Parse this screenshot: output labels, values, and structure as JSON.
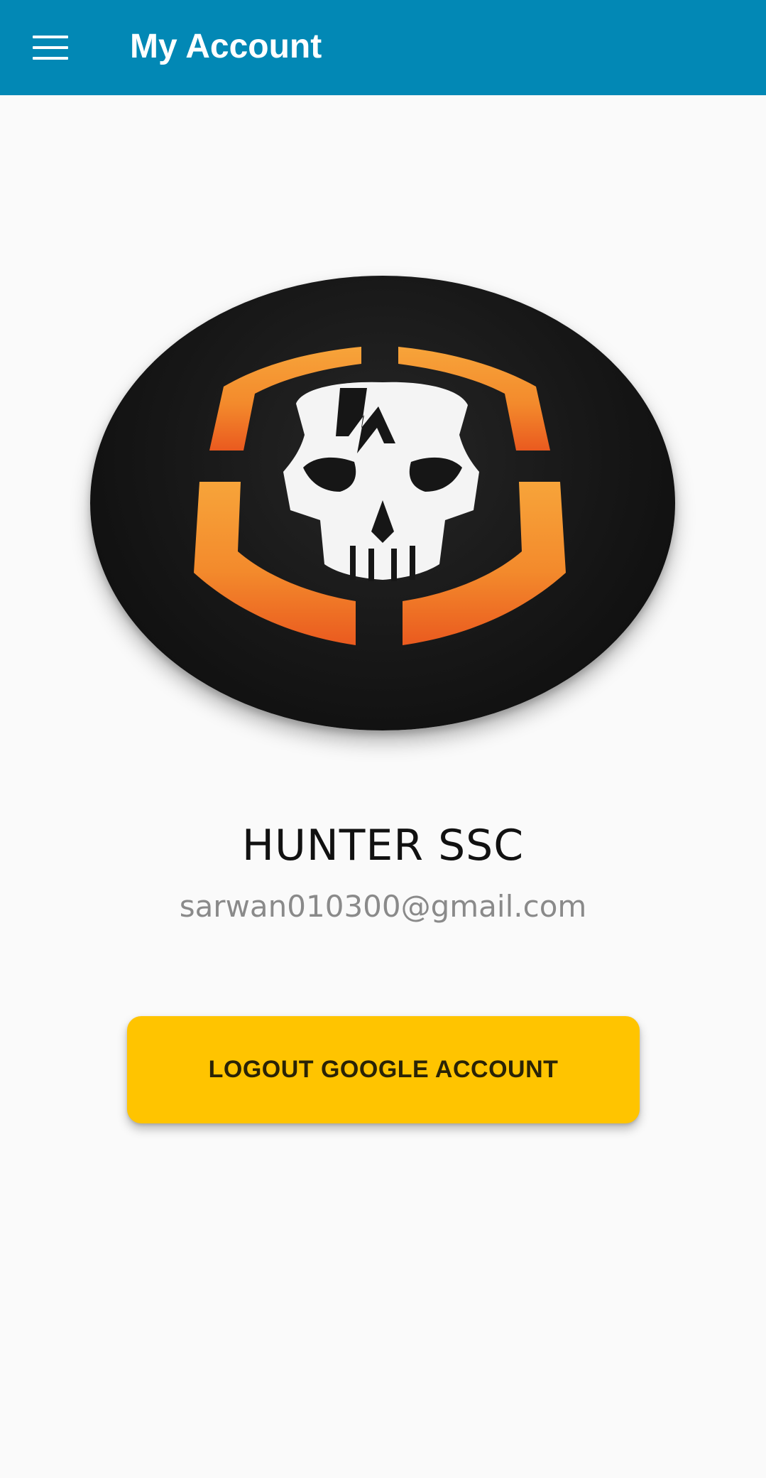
{
  "app_bar": {
    "title": "My Account",
    "menu_icon": "hamburger-menu-icon",
    "background_color": "#0288b5"
  },
  "profile": {
    "avatar_icon": "skull-shield-logo",
    "name": "HUNTER SSC",
    "email": "sarwan010300@gmail.com"
  },
  "actions": {
    "logout_label": "LOGOUT GOOGLE ACCOUNT",
    "logout_color": "#ffc400"
  }
}
